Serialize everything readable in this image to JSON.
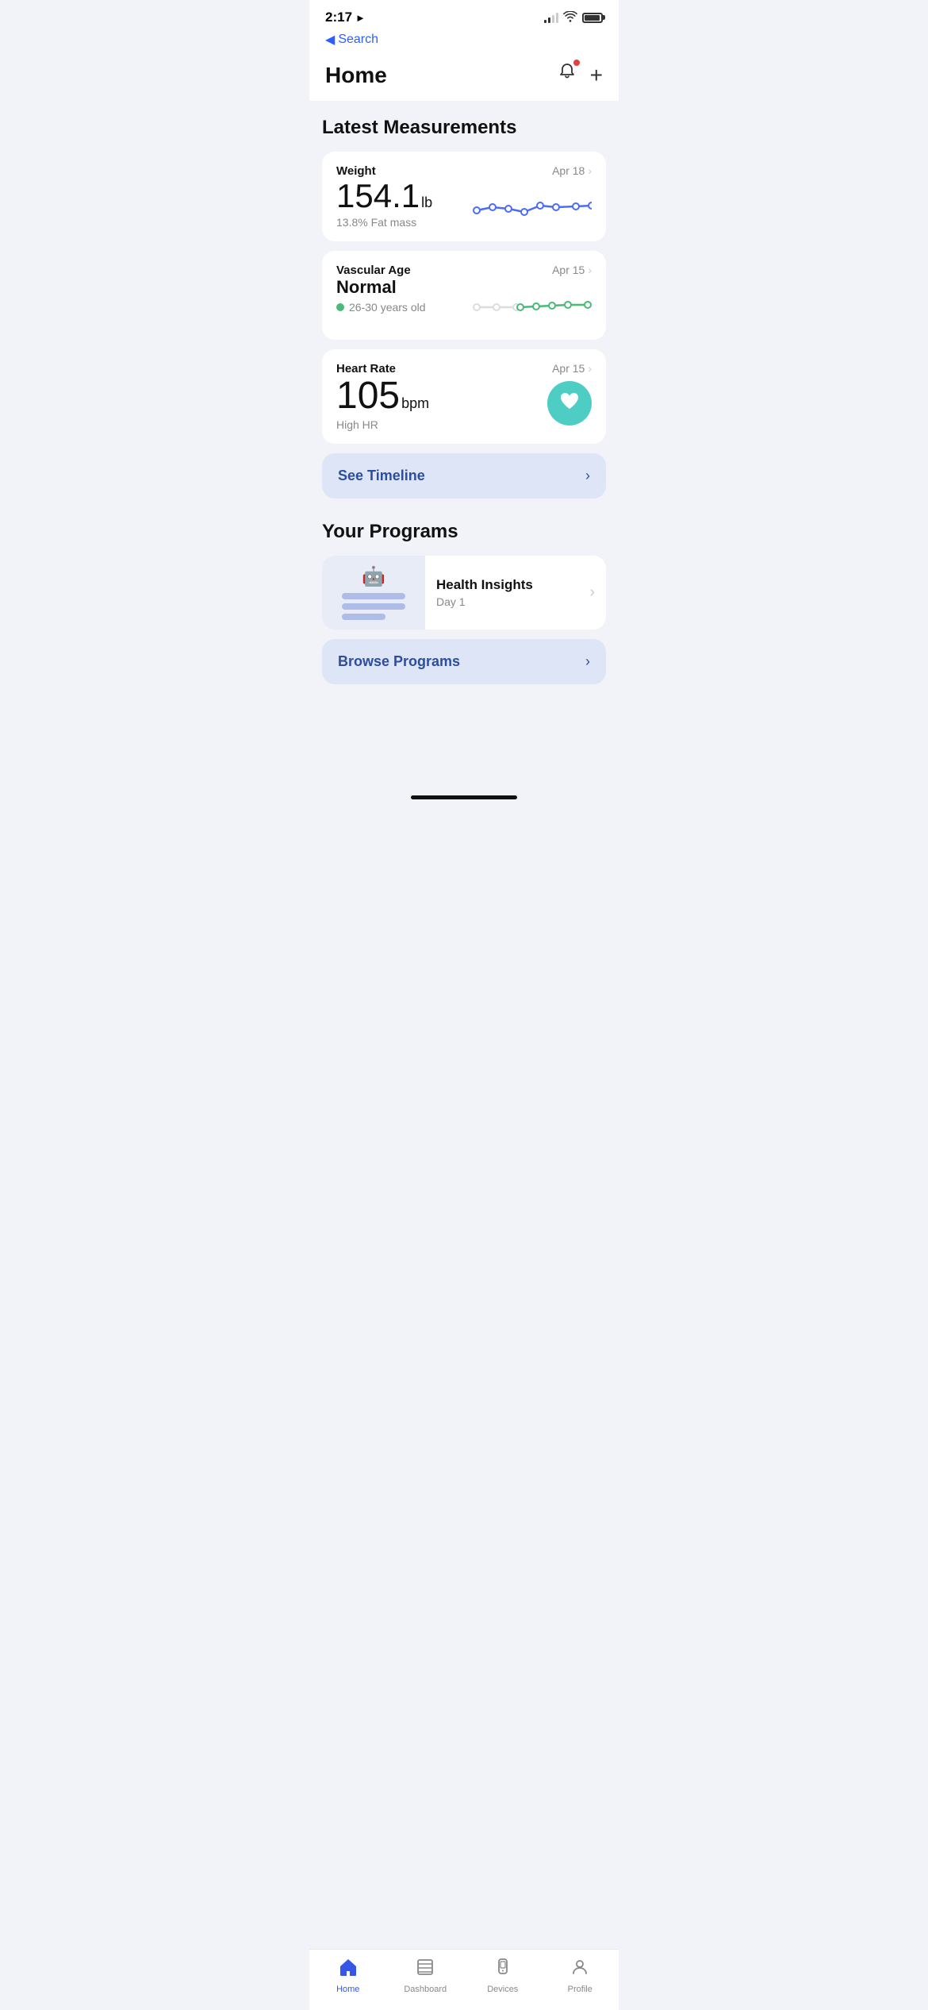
{
  "statusBar": {
    "time": "2:17",
    "backLabel": "Search"
  },
  "header": {
    "title": "Home",
    "notificationBadge": true
  },
  "sections": {
    "latestMeasurements": {
      "title": "Latest Measurements",
      "cards": [
        {
          "id": "weight",
          "label": "Weight",
          "value": "154.1",
          "unit": "lb",
          "subtext": "13.8% Fat mass",
          "date": "Apr 18",
          "chartType": "line-blue"
        },
        {
          "id": "vascular-age",
          "labelLine1": "Vascular Age",
          "labelLine2": "Normal",
          "subtext": "26-30 years old",
          "date": "Apr 15",
          "chartType": "line-green",
          "showDot": true
        },
        {
          "id": "heart-rate",
          "label": "Heart Rate",
          "value": "105",
          "unit": "bpm",
          "subtext": "High HR",
          "date": "Apr 15",
          "chartType": "heart-icon"
        }
      ]
    },
    "seeTimeline": {
      "label": "See Timeline"
    },
    "yourPrograms": {
      "title": "Your Programs",
      "programs": [
        {
          "id": "health-insights",
          "title": "Health Insights",
          "subtitle": "Day 1"
        }
      ],
      "browseLabel": "Browse Programs"
    }
  },
  "tabBar": {
    "items": [
      {
        "id": "home",
        "label": "Home",
        "active": true
      },
      {
        "id": "dashboard",
        "label": "Dashboard",
        "active": false
      },
      {
        "id": "devices",
        "label": "Devices",
        "active": false
      },
      {
        "id": "profile",
        "label": "Profile",
        "active": false
      }
    ]
  }
}
